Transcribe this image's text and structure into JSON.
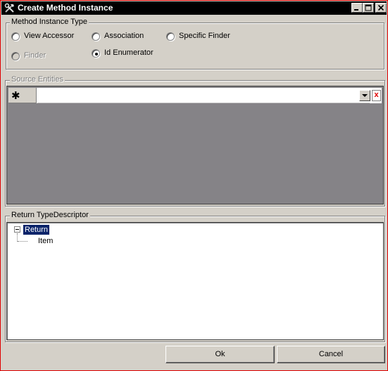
{
  "window": {
    "title": "Create Method Instance",
    "title_icon": "hammer-wrench-icon",
    "controls": [
      "minimize-icon",
      "maximize-icon",
      "close-icon"
    ]
  },
  "method_instance_type": {
    "legend": "Method Instance Type",
    "options": [
      {
        "label": "View Accessor",
        "selected": false,
        "enabled": true
      },
      {
        "label": "Association",
        "selected": false,
        "enabled": true
      },
      {
        "label": "Specific Finder",
        "selected": false,
        "enabled": true
      },
      {
        "label": "Finder",
        "selected": false,
        "enabled": false
      },
      {
        "label": "Id Enumerator",
        "selected": true,
        "enabled": true
      }
    ]
  },
  "source_entities": {
    "legend": "Source Entities",
    "new_row_marker": "✱",
    "combo_value": "",
    "delete_symbol": "x"
  },
  "return_type_descriptor": {
    "legend": "Return TypeDescriptor",
    "root": {
      "label": "Return",
      "expanded": true,
      "selected": true
    },
    "children": [
      {
        "label": "Item"
      }
    ]
  },
  "buttons": {
    "ok": "Ok",
    "cancel": "Cancel"
  },
  "colors": {
    "title_bar": "#000000",
    "selection": "#0a246a",
    "grid_background": "#858387",
    "dialog_face": "#d4d0c8",
    "delete_x": "#e00000"
  }
}
